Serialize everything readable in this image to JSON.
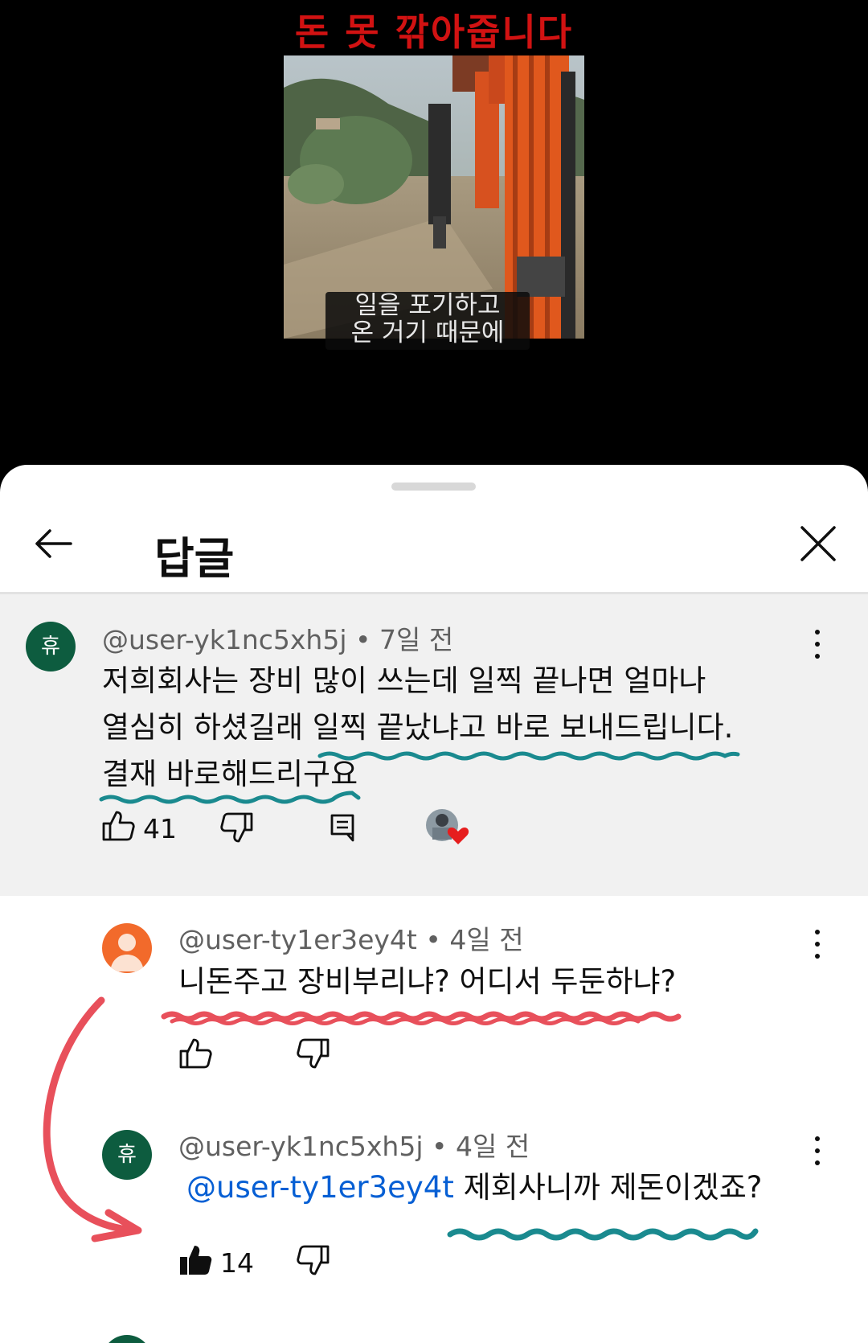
{
  "video": {
    "title_overlay": "돈 못 깎아줍니다",
    "subtitle_line1": "일을 포기하고",
    "subtitle_line2": "온 거기 때문에"
  },
  "sheet": {
    "title": "답글"
  },
  "parent_comment": {
    "avatar_letter": "휴",
    "author": "@user-yk1nc5xh5j",
    "time": "7일 전",
    "lines": [
      "저희회사는 장비 많이 쓰는데 일찍 끝나면 얼마나",
      "열심히 하셨길래 일찍 끝났냐고 바로 보내드립니다.",
      "결재 바로해드리구요"
    ],
    "likes": "41"
  },
  "replies": [
    {
      "author": "@user-ty1er3ey4t",
      "time": "4일 전",
      "text": "니돈주고 장비부리냐? 어디서  두둔하냐?"
    },
    {
      "avatar_letter": "휴",
      "author": "@user-yk1nc5xh5j",
      "time": "4일 전",
      "mention": "@user-ty1er3ey4t",
      "text": "제회사니까 제돈이겠죠?",
      "likes": "14"
    }
  ],
  "colors": {
    "accent_blue": "#065fd4",
    "annotation_teal": "#1a8a8f",
    "annotation_red": "#e8505b",
    "title_red": "#d11212"
  }
}
